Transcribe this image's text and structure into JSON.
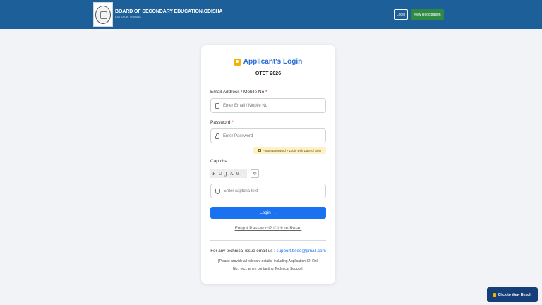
{
  "header": {
    "org_name": "BOARD OF SECONDARY EDUCATION,ODISHA",
    "org_sub": "CUTTACK, ODISHA",
    "login_label": "Login",
    "register_label": "New Registration",
    "bg_color": "#1c5f99"
  },
  "card": {
    "title": "Applicant's Login",
    "exam": "OTET 2026",
    "email_label": "Email Address / Mobile No",
    "email_placeholder": "Enter Email / Mobile No",
    "password_label": "Password",
    "password_placeholder": "Enter Password",
    "required_mark": "*",
    "forgot_dob_label": "Forgot password ? Login with Date of Birth",
    "captcha_label": "Captcha",
    "captcha_text": "FUJK9",
    "refresh_icon": "↻",
    "captcha_placeholder": "Enter captcha text",
    "login_button": "Login →",
    "forgot_link": "Forgot Password? Click to Reset",
    "support_text": "For any technical issue email us :",
    "support_email": "support.bseo@gmail.com",
    "note_text": "[Please provide all relevant details, including Application ID, Roll No., etc., when contacting Technical Support]"
  },
  "floating": {
    "result_label": "Click to View Result"
  },
  "colors": {
    "accent": "#1a72f0",
    "title": "#2b6fd6",
    "register_green": "#2e8a43",
    "result_bg": "#163f7a"
  }
}
